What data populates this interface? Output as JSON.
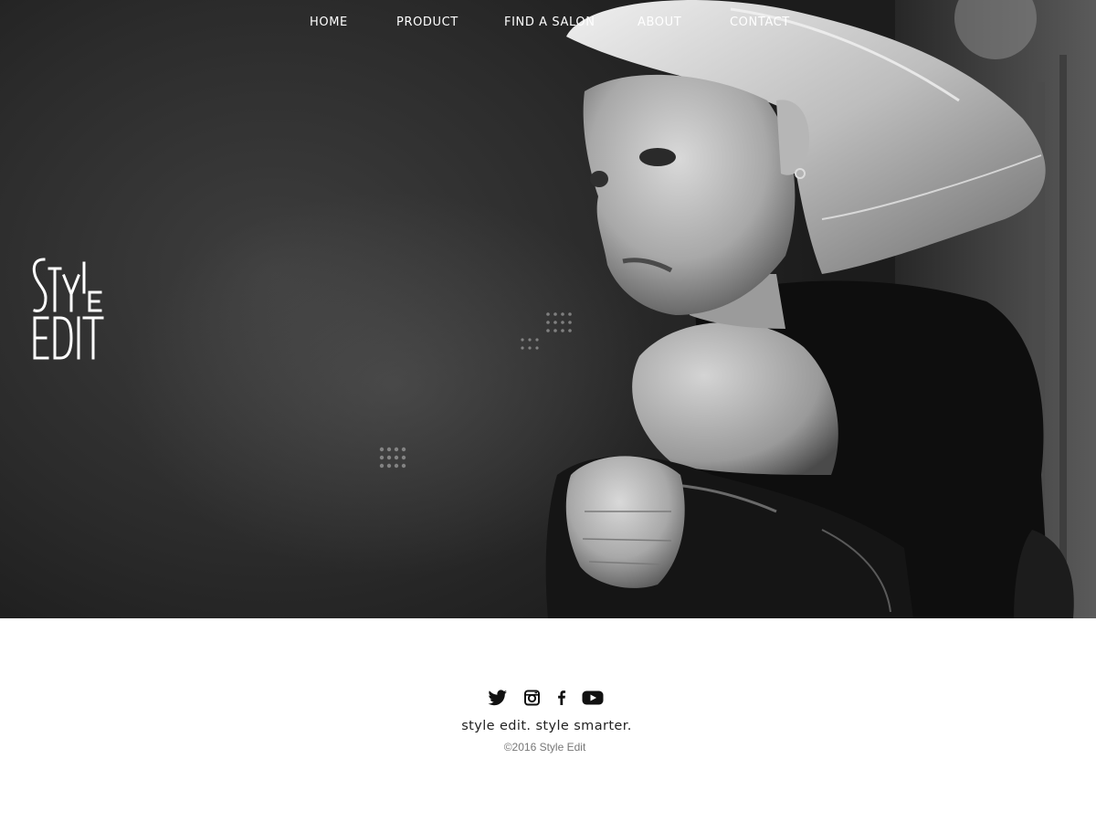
{
  "nav": {
    "items": [
      {
        "label": "HOME"
      },
      {
        "label": "PRODUCT"
      },
      {
        "label": "FIND A SALON"
      },
      {
        "label": "ABOUT"
      },
      {
        "label": "CONTACT"
      }
    ]
  },
  "logo": {
    "text": "Style Edit"
  },
  "footer": {
    "social": [
      {
        "icon": "twitter-icon"
      },
      {
        "icon": "instagram-icon"
      },
      {
        "icon": "facebook-icon"
      },
      {
        "icon": "youtube-icon"
      }
    ],
    "tagline": "style edit. style smarter.",
    "copyright": "©2016 Style Edit"
  },
  "colors": {
    "hero_background": "#2b2b2b",
    "nav_text": "#ffffff",
    "tagline_text": "#222222",
    "copyright_text": "#777777",
    "page_background": "#ffffff"
  }
}
